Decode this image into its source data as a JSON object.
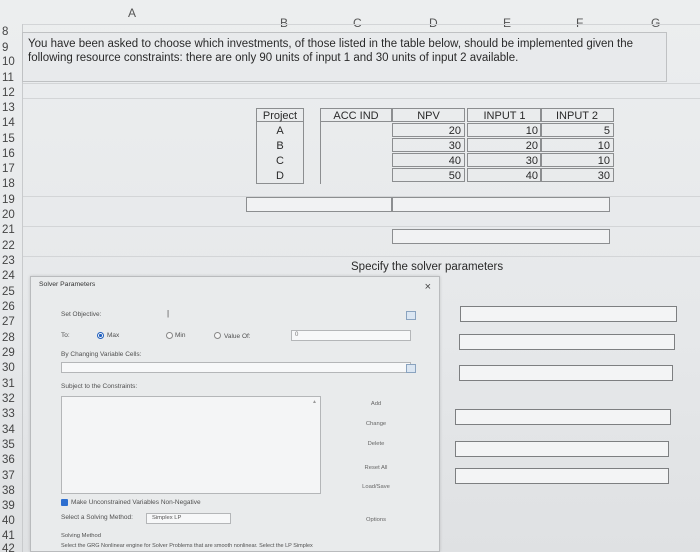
{
  "column_letters": [
    "A",
    "B",
    "C",
    "D",
    "E",
    "F",
    "G"
  ],
  "row_numbers": [
    "8",
    "9",
    "10",
    "11",
    "12",
    "13",
    "14",
    "15",
    "16",
    "17",
    "18",
    "19",
    "20",
    "21",
    "22",
    "23",
    "24",
    "25",
    "26",
    "27",
    "28",
    "29",
    "30",
    "31",
    "32",
    "33",
    "34",
    "35",
    "36",
    "37",
    "38",
    "39",
    "40",
    "41",
    "42"
  ],
  "question": {
    "line1": "You have been asked to choose which investments, of those listed in the table below, should be implemented given the",
    "line2": "following resource constraints: there are only 90 units of input 1 and 30 units of input 2 available."
  },
  "table": {
    "headers": {
      "project": "Project",
      "acc_ind": "ACC IND",
      "npv": "NPV",
      "input1": "INPUT 1",
      "input2": "INPUT 2"
    },
    "rows": [
      {
        "project": "A",
        "npv": "20",
        "input1": "10",
        "input2": "5"
      },
      {
        "project": "B",
        "npv": "30",
        "input1": "20",
        "input2": "10"
      },
      {
        "project": "C",
        "npv": "40",
        "input1": "30",
        "input2": "10"
      },
      {
        "project": "D",
        "npv": "50",
        "input1": "40",
        "input2": "30"
      }
    ]
  },
  "specify_text": "Specify the solver parameters",
  "solver": {
    "title": "Solver Parameters",
    "close_glyph": "×",
    "set_objective_label": "Set Objective:",
    "to_label": "To:",
    "max_label": "Max",
    "min_label": "Min",
    "value_of_label": "Value Of:",
    "value_of_value": "0",
    "changing_cells_label": "By Changing Variable Cells:",
    "subject_to_label": "Subject to the Constraints:",
    "buttons": {
      "add": "Add",
      "change": "Change",
      "delete": "Delete",
      "reset_all": "Reset All",
      "load_save": "Load/Save",
      "options": "Options"
    },
    "nonneg_label": "Make Unconstrained Variables Non-Negative",
    "select_method_label": "Select a Solving Method:",
    "method_value": "Simplex LP",
    "solving_method_title": "Solving Method",
    "solving_method_desc": "Select the GRG Nonlinear engine for Solver Problems that are smooth nonlinear. Select the LP Simplex"
  }
}
